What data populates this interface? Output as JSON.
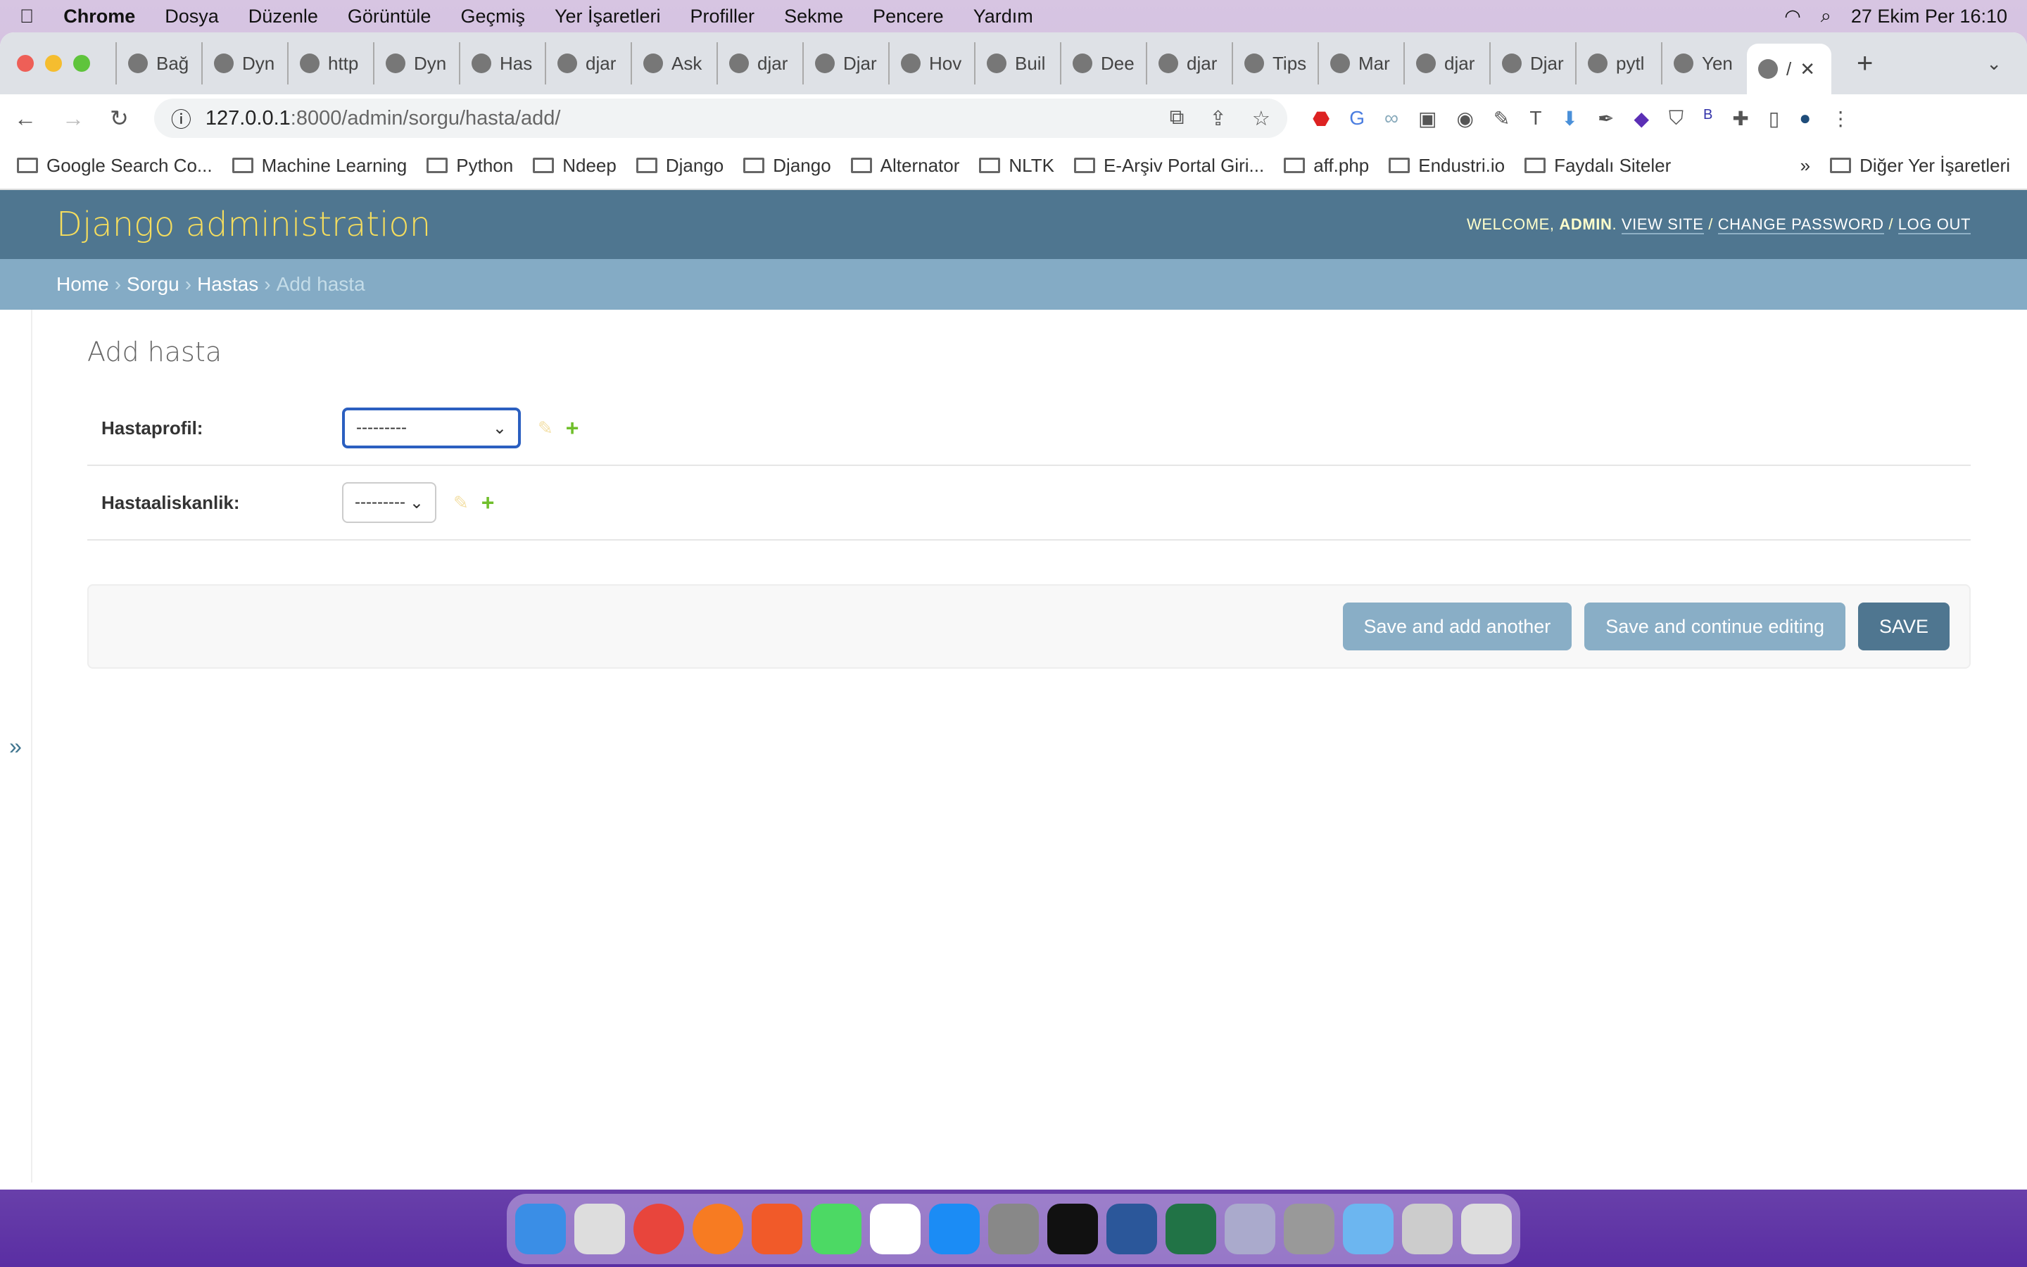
{
  "menubar": {
    "app": "Chrome",
    "items": [
      "Dosya",
      "Düzenle",
      "Görüntüle",
      "Geçmiş",
      "Yer İşaretleri",
      "Profiller",
      "Sekme",
      "Pencere",
      "Yardım"
    ],
    "clock": "27 Ekim Per  16:10"
  },
  "tabs": [
    "Bağ",
    "Dyn",
    "http",
    "Dyn",
    "Has",
    "djar",
    "Ask",
    "djar",
    "Djar",
    "Hov",
    "Buil",
    "Dee",
    "djar",
    "Tips",
    "Mar",
    "djar",
    "Djar",
    "pytl",
    "Yen"
  ],
  "active_tab": "/",
  "address": {
    "host": "127.0.0.1",
    "path": ":8000/admin/sorgu/hasta/add/"
  },
  "bookmarks": [
    "Google Search Co...",
    "Machine Learning",
    "Python",
    "Ndeep",
    "Django",
    "Django",
    "Alternator",
    "NLTK",
    "E-Arşiv Portal Giri...",
    "aff.php",
    "Endustri.io",
    "Faydalı Siteler"
  ],
  "bookmarks_more": "»",
  "bookmarks_other": "Diğer Yer İşaretleri",
  "admin": {
    "brand": "Django administration",
    "welcome": "Welcome,",
    "user": "admin",
    "view_site": "View site",
    "change_password": "Change password",
    "logout": "Log out"
  },
  "breadcrumbs": {
    "home": "Home",
    "app": "Sorgu",
    "model": "Hastas",
    "current": "Add hasta"
  },
  "page_title": "Add hasta",
  "form": {
    "fields": [
      {
        "label": "Hastaprofil:",
        "value": "---------"
      },
      {
        "label": "Hastaaliskanlik:",
        "value": "---------"
      }
    ]
  },
  "buttons": {
    "save_add": "Save and add another",
    "save_continue": "Save and continue editing",
    "save": "SAVE"
  },
  "sidebar_toggle": "»",
  "colors": {
    "header": "#4f7690",
    "brand": "#f5dd5d",
    "breadcrumbs": "#84abc5",
    "add": "#70bf2b"
  }
}
